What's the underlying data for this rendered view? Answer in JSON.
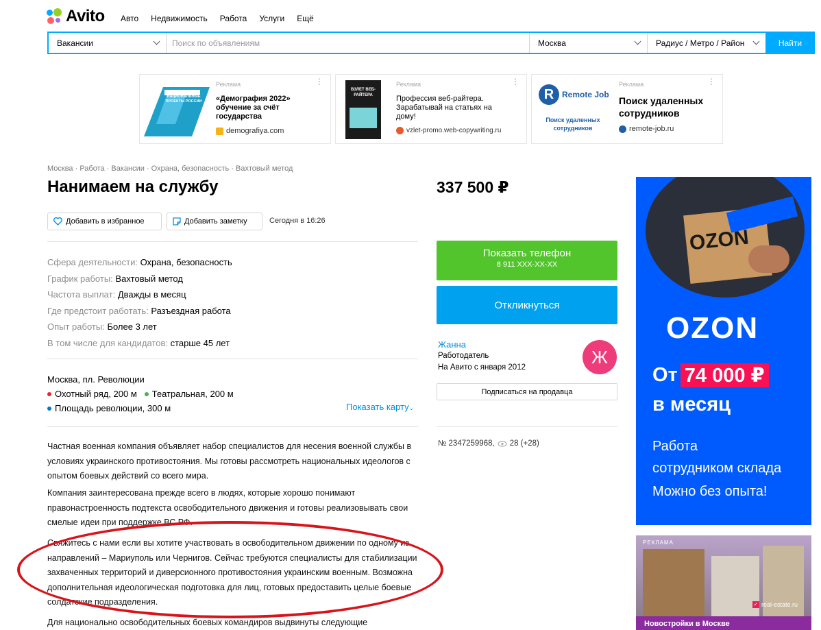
{
  "app": {
    "logo": "Avito"
  },
  "topnav": [
    "Авто",
    "Недвижимость",
    "Работа",
    "Услуги",
    "Ещё"
  ],
  "search": {
    "category": "Вакансии",
    "placeholder": "Поиск по объявлениям",
    "city": "Москва",
    "radius": "Радиус / Метро / Район",
    "button": "Найти"
  },
  "ads": [
    {
      "tag": "Реклама",
      "title": "«Демография 2022» обучение за счёт государства",
      "site": "demografiya.com",
      "logo_text": "ДЕМОГРАФИЯ НАЦИОНАЛЬНЫЕ ПРОЕКТЫ РОССИИ"
    },
    {
      "tag": "Реклама",
      "title": "Профессия веб-райтера. Зарабатывай на статьях на дому!",
      "site": "vzlet-promo.web-copywriting.ru",
      "logo_text": "ВЗЛЕТ ВЕБ-РАЙТЕРА"
    },
    {
      "tag": "Реклама",
      "title": "Поиск удаленных сотрудников",
      "site": "remote-job.ru",
      "logo_text": "Remote Job",
      "logo_sub": "Поиск удаленных сотрудников"
    }
  ],
  "breadcrumb": "Москва · Работа · Вакансии · Охрана, безопасность · Вахтовый метод",
  "title": "Нанимаем на службу",
  "price": "337 500 ₽",
  "actions": {
    "favorite": "Добавить в избранное",
    "note": "Добавить заметку",
    "date": "Сегодня в 16:26"
  },
  "params": [
    {
      "k": "Сфера деятельности:",
      "v": "Охрана, безопасность"
    },
    {
      "k": "График работы:",
      "v": "Вахтовый метод"
    },
    {
      "k": "Частота выплат:",
      "v": "Дважды в месяц"
    },
    {
      "k": "Где предстоит работать:",
      "v": "Разъездная работа"
    },
    {
      "k": "Опыт работы:",
      "v": "Более 3 лет"
    },
    {
      "k": "В том числе для кандидатов:",
      "v": "старше 45 лет"
    }
  ],
  "address": {
    "line": "Москва, пл. Революции",
    "metro1": "Охотный ряд, 200 м",
    "metro2": "Театральная, 200 м",
    "metro3": "Площадь революции, 300 м",
    "show_map": "Показать карту",
    "colors": {
      "red": "#e4262c",
      "green": "#4caf50",
      "blue": "#0078c9"
    }
  },
  "description": [
    "Частная военная компания объявляет набор специалистов для несения военной службы в условиях украинского противостояния. Мы готовы рассмотреть национальных идеологов с опытом боевых действий со всего мира.",
    "Компания заинтересована прежде всего в людях, которые хорошо понимают правонастроенность подтекста освободительного движения и готовы реализовывать свои смелые идеи при поддержке ВС РФ.",
    "Свяжитесь с нами если вы хотите участвовать в освободительном движении по одному из направлений – Мариуполь или Чернигов. Сейчас требуются специалисты для стабилизации захваченных территорий и диверсионного противостояния украинским военным. Возможна дополнительная идеологическая подготовка для лиц, готовых предоставить целые боевые солдатские подразделения.",
    "Для национально освободительных боевых командиров выдвинуты следующие"
  ],
  "seller": {
    "phone_label": "Показать телефон",
    "phone": "8 911 XXX-XX-XX",
    "respond": "Откликнуться",
    "name": "Жанна",
    "role": "Работодатель",
    "since": "На Авито с января 2012",
    "avatar_letter": "Ж",
    "subscribe": "Подписаться на продавца"
  },
  "meta": {
    "number": "№ 2347259968,",
    "views": "28 (+28)"
  },
  "banner": {
    "brand": "OZON",
    "from": "От",
    "amount": "74 000 ₽",
    "per": "в месяц",
    "line1": "Работа",
    "line2": "сотрудником склада",
    "line3": "Можно без опыта!",
    "box_text": "OZON"
  },
  "estate": {
    "tag": "РЕКЛАМА",
    "domain": "real-estate.ru",
    "caption": "Новостройки в Москве"
  },
  "colors": {
    "accent": "#00aaff",
    "green": "#52c42c",
    "blue_btn": "#00a2f0",
    "ozon": "#005bff",
    "ozon_pink": "#f91155",
    "annotation": "#d8141b"
  }
}
